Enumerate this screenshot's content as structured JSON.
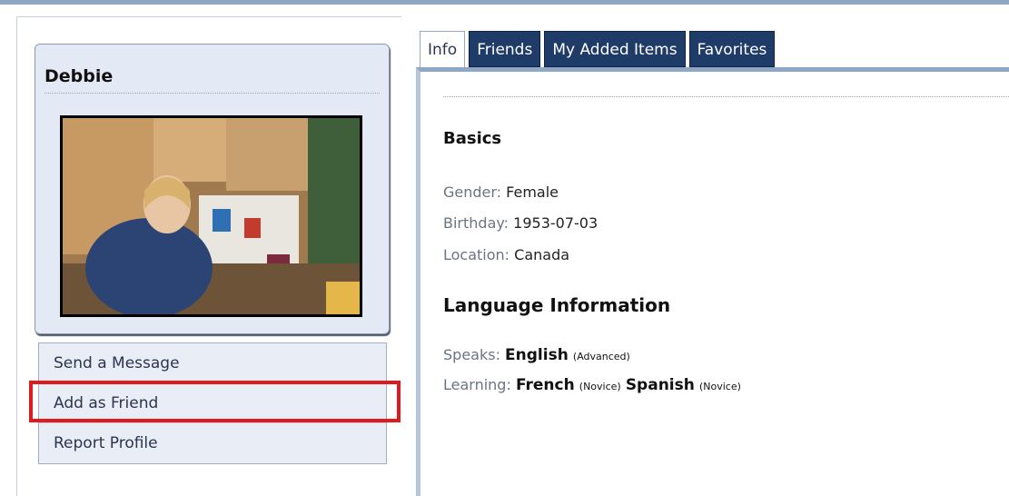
{
  "profile": {
    "name": "Debbie",
    "photo_icon": "profile-photo"
  },
  "actions": [
    {
      "label": "Send a Message"
    },
    {
      "label": "Add as Friend"
    },
    {
      "label": "Report Profile"
    }
  ],
  "highlight_color": "#e0191d",
  "tabs": [
    {
      "label": "Info",
      "active": true
    },
    {
      "label": "Friends",
      "active": false
    },
    {
      "label": "My Added Items",
      "active": false
    },
    {
      "label": "Favorites",
      "active": false
    }
  ],
  "basics": {
    "title": "Basics",
    "gender_label": "Gender:",
    "gender_value": "Female",
    "birthday_label": "Birthday:",
    "birthday_value": "1953-07-03",
    "location_label": "Location:",
    "location_value": "Canada"
  },
  "language": {
    "title": "Language Information",
    "speaks_label": "Speaks:",
    "speaks": [
      {
        "name": "English",
        "level": "(Advanced)"
      }
    ],
    "learning_label": "Learning:",
    "learning": [
      {
        "name": "French",
        "level": "(Novice)"
      },
      {
        "name": "Spanish",
        "level": "(Novice)"
      }
    ]
  },
  "colors": {
    "tab_bg": "#1f3c68",
    "card_bg": "#e3e9f5",
    "accent_rule": "#8fa7c6"
  }
}
